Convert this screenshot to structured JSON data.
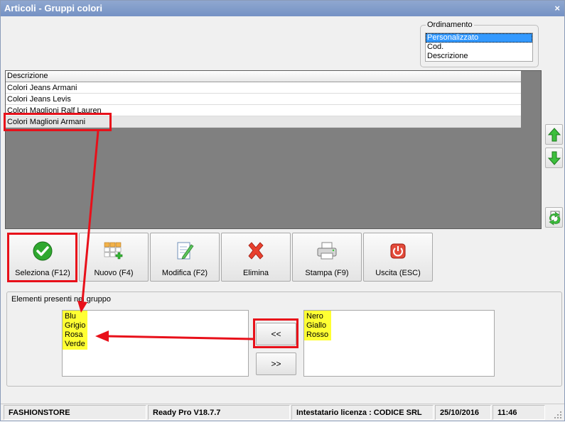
{
  "window": {
    "title": "Articoli - Gruppi colori",
    "close_glyph": "×"
  },
  "ordinamento": {
    "legend": "Ordinamento",
    "options": [
      "Personalizzato",
      "Cod.",
      "Descrizione"
    ],
    "selected_index": 0
  },
  "grid": {
    "header": "Descrizione",
    "rows": [
      "Colori Jeans Armani",
      "Colori Jeans Levis",
      "Colori Maglioni Ralf Lauren",
      "Colori Maglioni Armani"
    ],
    "selected_index": 3
  },
  "side_buttons": [
    {
      "name": "move-up",
      "icon": "arrow-up-icon"
    },
    {
      "name": "move-down",
      "icon": "arrow-down-icon"
    },
    {
      "name": "refresh",
      "icon": "refresh-icon"
    }
  ],
  "toolbar": {
    "seleziona": "Seleziona (F12)",
    "nuovo": "Nuovo (F4)",
    "modifica": "Modifica (F2)",
    "elimina": "Elimina",
    "stampa": "Stampa (F9)",
    "uscita": "Uscita (ESC)"
  },
  "elementi": {
    "legend": "Elementi presenti nel gruppo",
    "present": [
      "Blu",
      "Grigio",
      "Rosa",
      "Verde"
    ],
    "available": [
      "Nero",
      "Giallo",
      "Rosso"
    ],
    "add_label": "<<",
    "remove_label": ">>"
  },
  "status": {
    "company": "FASHIONSTORE",
    "version": "Ready Pro V18.7.7",
    "license": "Intestatario licenza : CODICE SRL",
    "date": "25/10/2016",
    "time": "11:46"
  },
  "colors": {
    "title_bar": "#7f9ac9",
    "annotation": "#e8101a",
    "highlight": "#ffff33",
    "selection": "#3399ff"
  }
}
